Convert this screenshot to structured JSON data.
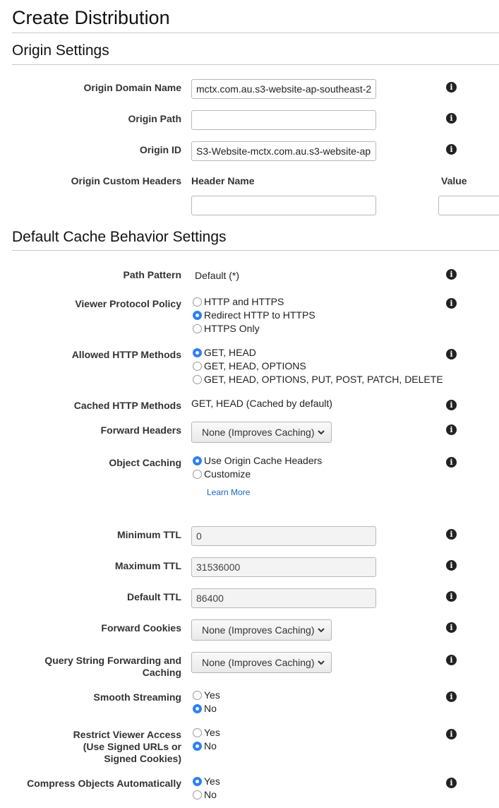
{
  "page_title": "Create Distribution",
  "origin_settings": {
    "heading": "Origin Settings",
    "domain_name": {
      "label": "Origin Domain Name",
      "value": "mctx.com.au.s3-website-ap-southeast-2"
    },
    "path": {
      "label": "Origin Path",
      "value": ""
    },
    "id": {
      "label": "Origin ID",
      "value": "S3-Website-mctx.com.au.s3-website-ap"
    },
    "custom_headers": {
      "label": "Origin Custom Headers",
      "header_name_col": "Header Name",
      "value_col": "Value",
      "header_name_value": "",
      "value_value": ""
    }
  },
  "cache_behavior": {
    "heading": "Default Cache Behavior Settings",
    "path_pattern": {
      "label": "Path Pattern",
      "value": "Default (*)"
    },
    "viewer_protocol": {
      "label": "Viewer Protocol Policy",
      "options": [
        "HTTP and HTTPS",
        "Redirect HTTP to HTTPS",
        "HTTPS Only"
      ],
      "selected": "Redirect HTTP to HTTPS"
    },
    "allowed_methods": {
      "label": "Allowed HTTP Methods",
      "options": [
        "GET, HEAD",
        "GET, HEAD, OPTIONS",
        "GET, HEAD, OPTIONS, PUT, POST, PATCH, DELETE"
      ],
      "selected": "GET, HEAD"
    },
    "cached_methods": {
      "label": "Cached HTTP Methods",
      "value": "GET, HEAD (Cached by default)"
    },
    "forward_headers": {
      "label": "Forward Headers",
      "value": "None (Improves Caching)"
    },
    "object_caching": {
      "label": "Object Caching",
      "options": [
        "Use Origin Cache Headers",
        "Customize"
      ],
      "selected": "Use Origin Cache Headers",
      "learn_more": "Learn More"
    },
    "min_ttl": {
      "label": "Minimum TTL",
      "value": "0"
    },
    "max_ttl": {
      "label": "Maximum TTL",
      "value": "31536000"
    },
    "default_ttl": {
      "label": "Default TTL",
      "value": "86400"
    },
    "forward_cookies": {
      "label": "Forward Cookies",
      "value": "None (Improves Caching)"
    },
    "query_string": {
      "label_line1": "Query String Forwarding and",
      "label_line2": "Caching",
      "value": "None (Improves Caching)"
    },
    "smooth_streaming": {
      "label": "Smooth Streaming",
      "options": [
        "Yes",
        "No"
      ],
      "selected": "No"
    },
    "restrict_access": {
      "label_line1": "Restrict Viewer Access",
      "label_line2": "(Use Signed URLs or",
      "label_line3": "Signed Cookies)",
      "options": [
        "Yes",
        "No"
      ],
      "selected": "No"
    },
    "compress": {
      "label": "Compress Objects Automatically",
      "options": [
        "Yes",
        "No"
      ],
      "selected": "Yes"
    }
  },
  "icons": {
    "info": "info-icon",
    "dropdown": "chevron-down-icon"
  },
  "colors": {
    "radio_selected": "#2f7ff5",
    "link": "#1a66c2",
    "rule": "#c9c9c9"
  }
}
